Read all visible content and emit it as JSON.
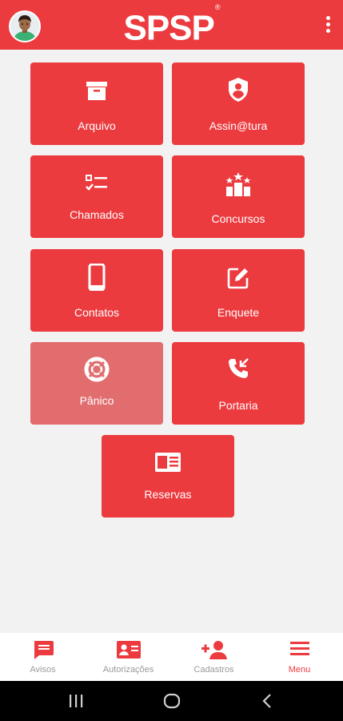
{
  "app": {
    "logo": "SPSP",
    "logo_mark": "®"
  },
  "header": {
    "avatar_icon": "user-avatar",
    "menu_icon": "kebab-menu-icon"
  },
  "colors": {
    "primary": "#ec3b3f",
    "disabled_tile": "#e26d6f",
    "background": "#f2f2f2",
    "nav_inactive": "#9a9a9a"
  },
  "tiles": [
    {
      "label": "Arquivo",
      "icon": "archive-icon"
    },
    {
      "label": "Assin@tura",
      "icon": "shield-user-icon"
    },
    {
      "label": "Chamados",
      "icon": "checklist-icon"
    },
    {
      "label": "Concursos",
      "icon": "podium-stars-icon"
    },
    {
      "label": "Contatos",
      "icon": "phone-icon"
    },
    {
      "label": "Enquete",
      "icon": "edit-icon"
    },
    {
      "label": "Pânico",
      "icon": "lifebuoy-icon"
    },
    {
      "label": "Portaria",
      "icon": "phone-incoming-icon"
    },
    {
      "label": "Reservas",
      "icon": "reservation-card-icon"
    }
  ],
  "bottom_nav": [
    {
      "label": "Avisos",
      "icon": "announcement-icon"
    },
    {
      "label": "Autorizações",
      "icon": "id-card-icon"
    },
    {
      "label": "Cadastros",
      "icon": "add-user-icon"
    },
    {
      "label": "Menu",
      "icon": "hamburger-icon",
      "active": true
    }
  ]
}
